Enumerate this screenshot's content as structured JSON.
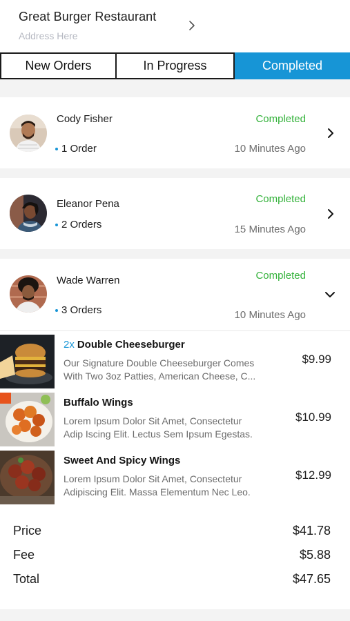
{
  "header": {
    "restaurant_name": "Great Burger Restaurant",
    "address": "Address Here"
  },
  "tabs": [
    {
      "label": "New Orders",
      "active": false
    },
    {
      "label": "In Progress",
      "active": false
    },
    {
      "label": "Completed",
      "active": true
    }
  ],
  "colors": {
    "accent": "#1795d6",
    "status_completed": "#33b23a"
  },
  "orders": [
    {
      "customer": "Cody Fisher",
      "count": "1 Order",
      "status": "Completed",
      "time": "10 Minutes Ago",
      "expanded": false
    },
    {
      "customer": "Eleanor Pena",
      "count": "2 Orders",
      "status": "Completed",
      "time": "15 Minutes Ago",
      "expanded": false
    },
    {
      "customer": "Wade Warren",
      "count": "3 Orders",
      "status": "Completed",
      "time": "10 Minutes Ago",
      "expanded": true
    }
  ],
  "items": [
    {
      "qty": "2x",
      "name": "Double Cheeseburger",
      "desc_line1": "Our Signature Double Cheeseburger Comes",
      "desc_line2": "With Two 3oz Patties, American Cheese, C...",
      "price": "$9.99"
    },
    {
      "qty": "",
      "name": "Buffalo Wings",
      "desc_line1": "Lorem Ipsum Dolor Sit Amet, Consectetur",
      "desc_line2": "Adip Iscing Elit. Lectus Sem Ipsum Egestas.",
      "price": "$10.99"
    },
    {
      "qty": "",
      "name": "Sweet And Spicy Wings",
      "desc_line1": "Lorem Ipsum Dolor Sit Amet, Consectetur",
      "desc_line2": "Adipiscing Elit. Massa Elementum Nec Leo.",
      "price": "$12.99"
    }
  ],
  "totals": {
    "price_label": "Price",
    "price": "$41.78",
    "fee_label": "Fee",
    "fee": "$5.88",
    "total_label": "Total",
    "total": "$47.65"
  }
}
